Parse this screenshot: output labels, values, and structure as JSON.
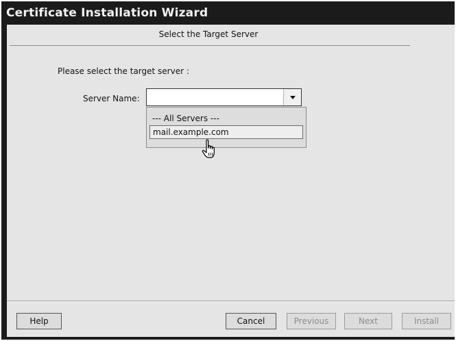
{
  "window": {
    "title": "Certificate Installation Wizard"
  },
  "page": {
    "heading": "Select the Target Server",
    "prompt": "Please select the target server :",
    "server_name_label": "Server Name:",
    "server_name_value": ""
  },
  "dropdown": {
    "options": [
      "--- All Servers ---",
      "mail.example.com"
    ],
    "highlighted": "mail.example.com"
  },
  "buttons": {
    "help": "Help",
    "cancel": "Cancel",
    "previous": "Previous",
    "next": "Next",
    "install": "Install"
  },
  "icons": {
    "cursor": "hand-pointer-icon",
    "combo_arrow": "chevron-down-icon"
  }
}
